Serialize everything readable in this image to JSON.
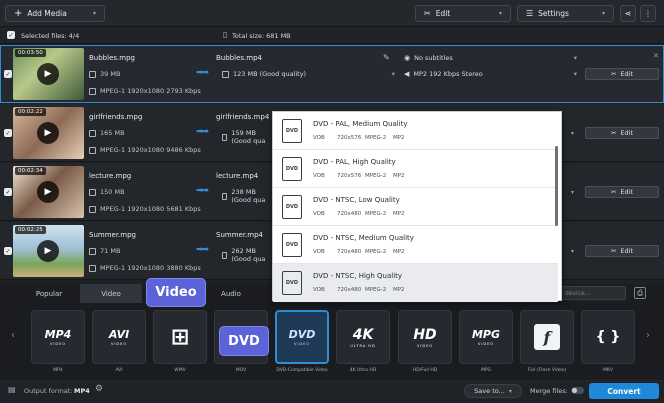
{
  "toolbar": {
    "add_media": "Add Media",
    "edit": "Edit",
    "settings": "Settings"
  },
  "selection": {
    "selected_label": "Selected files: 4/4",
    "total_size": "Total size: 681 MB"
  },
  "files": [
    {
      "duration": "00:03:50",
      "name": "Bubbles.mpg",
      "size": "39 MB",
      "codec": "MPEG-1 1920x1080 2793 Kbps",
      "out_name": "Bubbles.mp4",
      "out_size": "123 MB (Good quality)",
      "subtitles": "No subtitles",
      "audio": "MP2 192 Kbps Stereo",
      "edit": "Edit"
    },
    {
      "duration": "00:02:22",
      "name": "girlfriends.mpg",
      "size": "165 MB",
      "codec": "MPEG-1 1920x1080 9486 Kbps",
      "out_name": "girlfriends.mp4",
      "out_size": "159 MB (Good qua",
      "edit": "Edit"
    },
    {
      "duration": "00:02:34",
      "name": "lecture.mpg",
      "size": "150 MB",
      "codec": "MPEG-1 1920x1080 5681 Kbps",
      "out_name": "lecture.mp4",
      "out_size": "238 MB (Good qua",
      "edit": "Edit"
    },
    {
      "duration": "00:02:25",
      "name": "Summer.mpg",
      "size": "71 MB",
      "codec": "MPEG-1 1920x1080 3880 Kbps",
      "out_name": "Summer.mp4",
      "out_size": "262 MB (Good qua",
      "edit": "Edit"
    }
  ],
  "presets": [
    {
      "title": "DVD - PAL, Medium Quality",
      "format": "VOB",
      "res": "720x576",
      "video": "MPEG-2",
      "audio": "MP2"
    },
    {
      "title": "DVD - PAL, High Quality",
      "format": "VOB",
      "res": "720x576",
      "video": "MPEG-2",
      "audio": "MP2"
    },
    {
      "title": "DVD - NTSC, Low Quality",
      "format": "VOB",
      "res": "720x480",
      "video": "MPEG-2",
      "audio": "MP2"
    },
    {
      "title": "DVD - NTSC, Medium Quality",
      "format": "VOB",
      "res": "720x480",
      "video": "MPEG-2",
      "audio": "MP2"
    },
    {
      "title": "DVD - NTSC, High Quality",
      "format": "VOB",
      "res": "720x480",
      "video": "MPEG-2",
      "audio": "MP2"
    }
  ],
  "tabs": {
    "popular": "Popular",
    "video": "Video",
    "audio": "Audio",
    "search_placeholder": "device..."
  },
  "formats": [
    {
      "icon": "MP4",
      "sub": "VIDEO",
      "label": "MP4"
    },
    {
      "icon": "AVI",
      "sub": "VIDEO",
      "label": "AVI"
    },
    {
      "icon": "⊞",
      "sub": "",
      "label": "WMV"
    },
    {
      "icon": "MOV",
      "sub": "",
      "label": "MOV"
    },
    {
      "icon": "DVD",
      "sub": "VIDEO",
      "label": "DVD-Compatible Video"
    },
    {
      "icon": "4K",
      "sub": "ULTRA HD",
      "label": "4K Ultra HD"
    },
    {
      "icon": "HD",
      "sub": "VIDEO",
      "label": "HD/Full HD"
    },
    {
      "icon": "MPG",
      "sub": "VIDEO",
      "label": "MPG"
    },
    {
      "icon": "f",
      "sub": "",
      "label": "FLV (Flash Video)"
    },
    {
      "icon": "{ }",
      "sub": "",
      "label": "MKV"
    }
  ],
  "callouts": {
    "video": "Video",
    "dvd": "DVD"
  },
  "bottom": {
    "output_label": "Output format:",
    "output_value": "MP4",
    "save_to": "Save to...",
    "merge": "Merge files:",
    "convert": "Convert"
  },
  "colors": {
    "accent": "#2f8cd6",
    "callout": "#5c63d8",
    "convert": "#1f88d9"
  }
}
